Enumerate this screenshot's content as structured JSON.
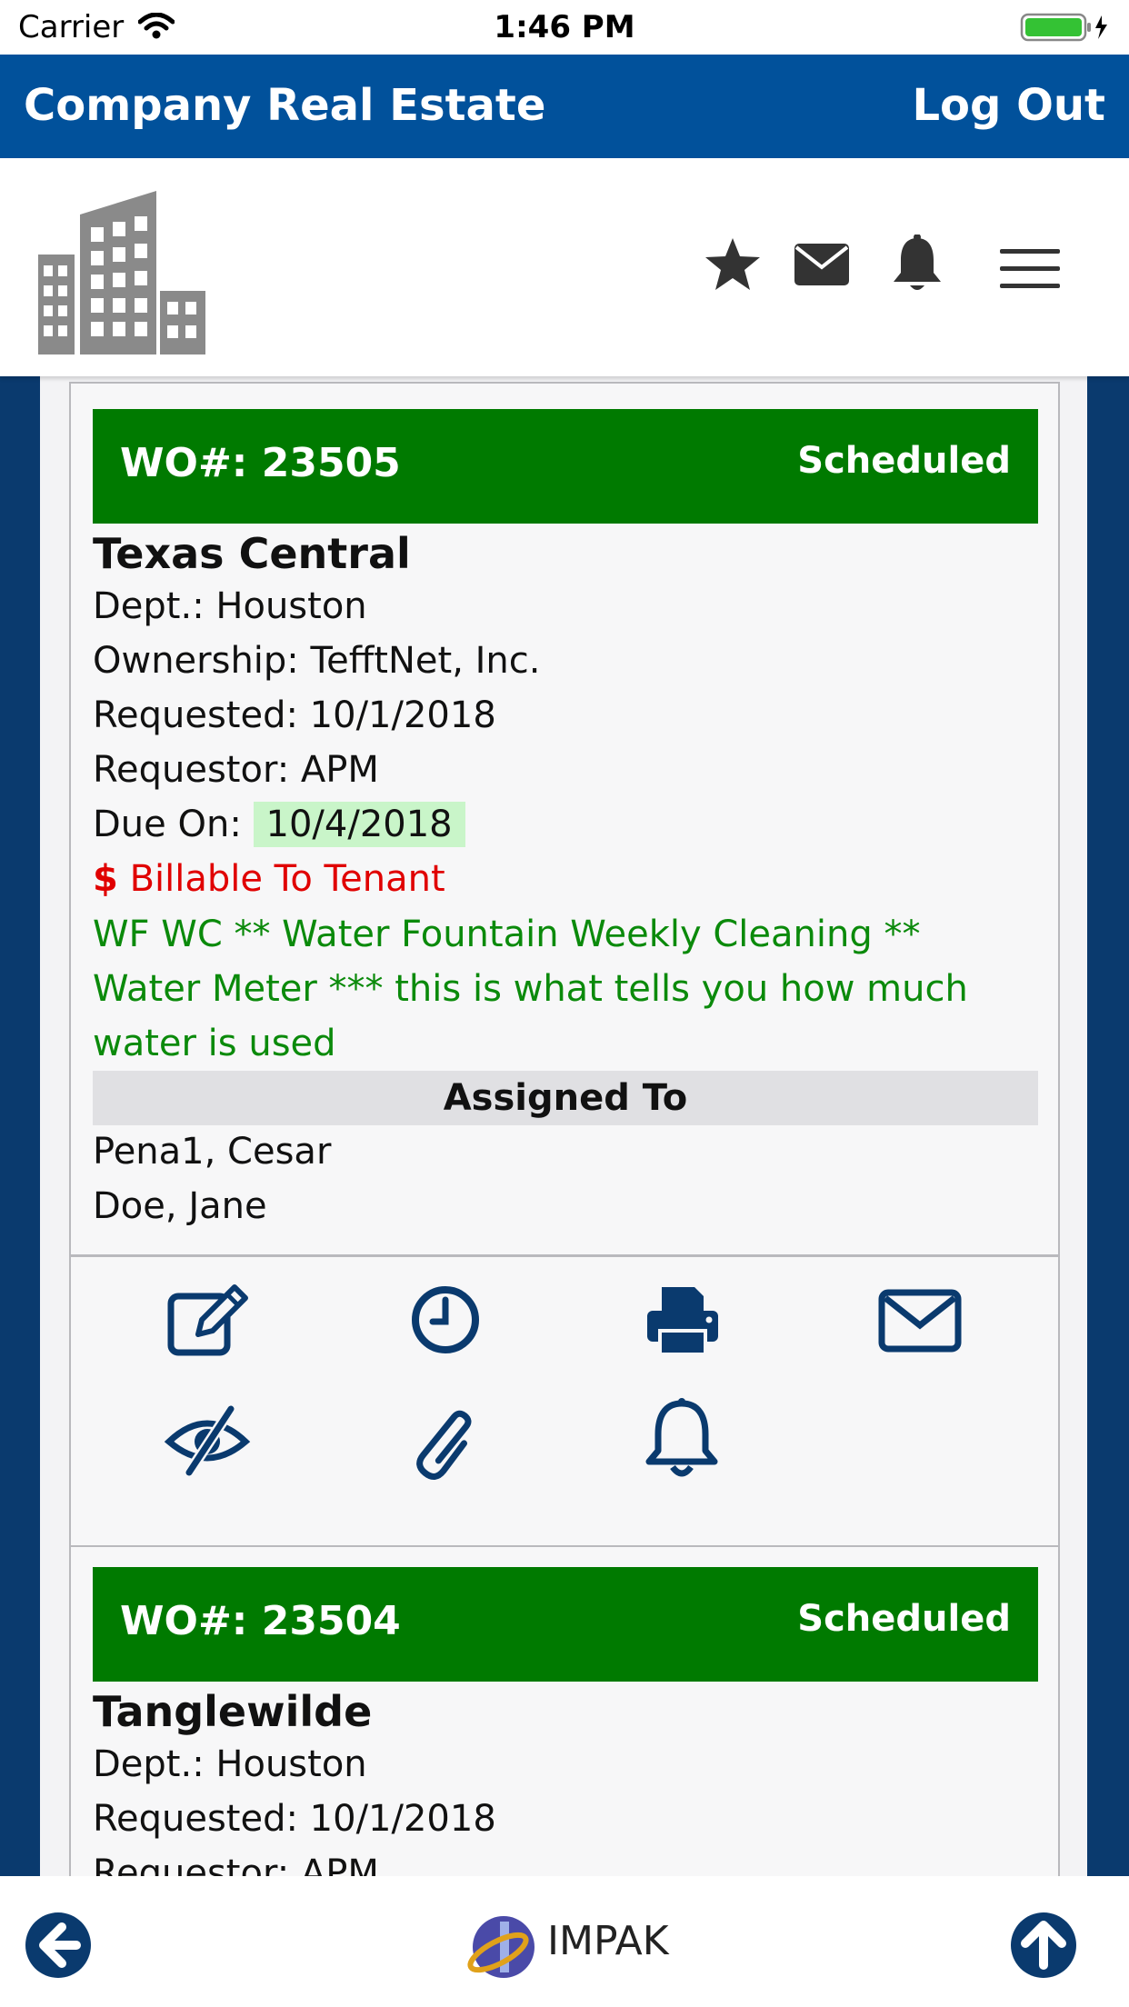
{
  "status_bar": {
    "carrier": "Carrier",
    "time": "1:46 PM"
  },
  "header": {
    "title": "Company Real Estate",
    "logout": "Log Out"
  },
  "toolbar_icons": [
    "star-icon",
    "mail-icon",
    "bell-icon",
    "hamburger-menu-icon"
  ],
  "work_orders": [
    {
      "wo_label": "WO#: 23505",
      "status": "Scheduled",
      "property": "Texas Central",
      "dept": "Dept.: Houston",
      "ownership": "Ownership: TefftNet, Inc.",
      "requested": "Requested: 10/1/2018",
      "requestor": "Requestor: APM",
      "due_label": "Due On:",
      "due_date": "10/4/2018",
      "billable_symbol": "$",
      "billable_text": "Billable To Tenant",
      "description": "WF WC ** Water Fountain Weekly Cleaning ** Water Meter *** this is what tells you how much water is used",
      "assigned_header": "Assigned To",
      "assignees": [
        "Pena1, Cesar",
        "Doe, Jane"
      ]
    },
    {
      "wo_label": "WO#: 23504",
      "status": "Scheduled",
      "property": "Tanglewilde",
      "dept": "Dept.: Houston",
      "requested": "Requested: 10/1/2018",
      "requestor": "Requestor: APM"
    }
  ],
  "card_actions": [
    "edit-icon",
    "clock-icon",
    "print-icon",
    "email-icon",
    "hide-icon",
    "attachment-icon",
    "notify-bell-icon"
  ],
  "footer": {
    "brand": "IMPAK"
  },
  "colors": {
    "header_blue": "#01519b",
    "status_green": "#007a00",
    "page_navy": "#0a3a6e",
    "billable_red": "#e00000",
    "desc_green": "#0b8a0b",
    "due_highlight": "#c9f5c9"
  }
}
